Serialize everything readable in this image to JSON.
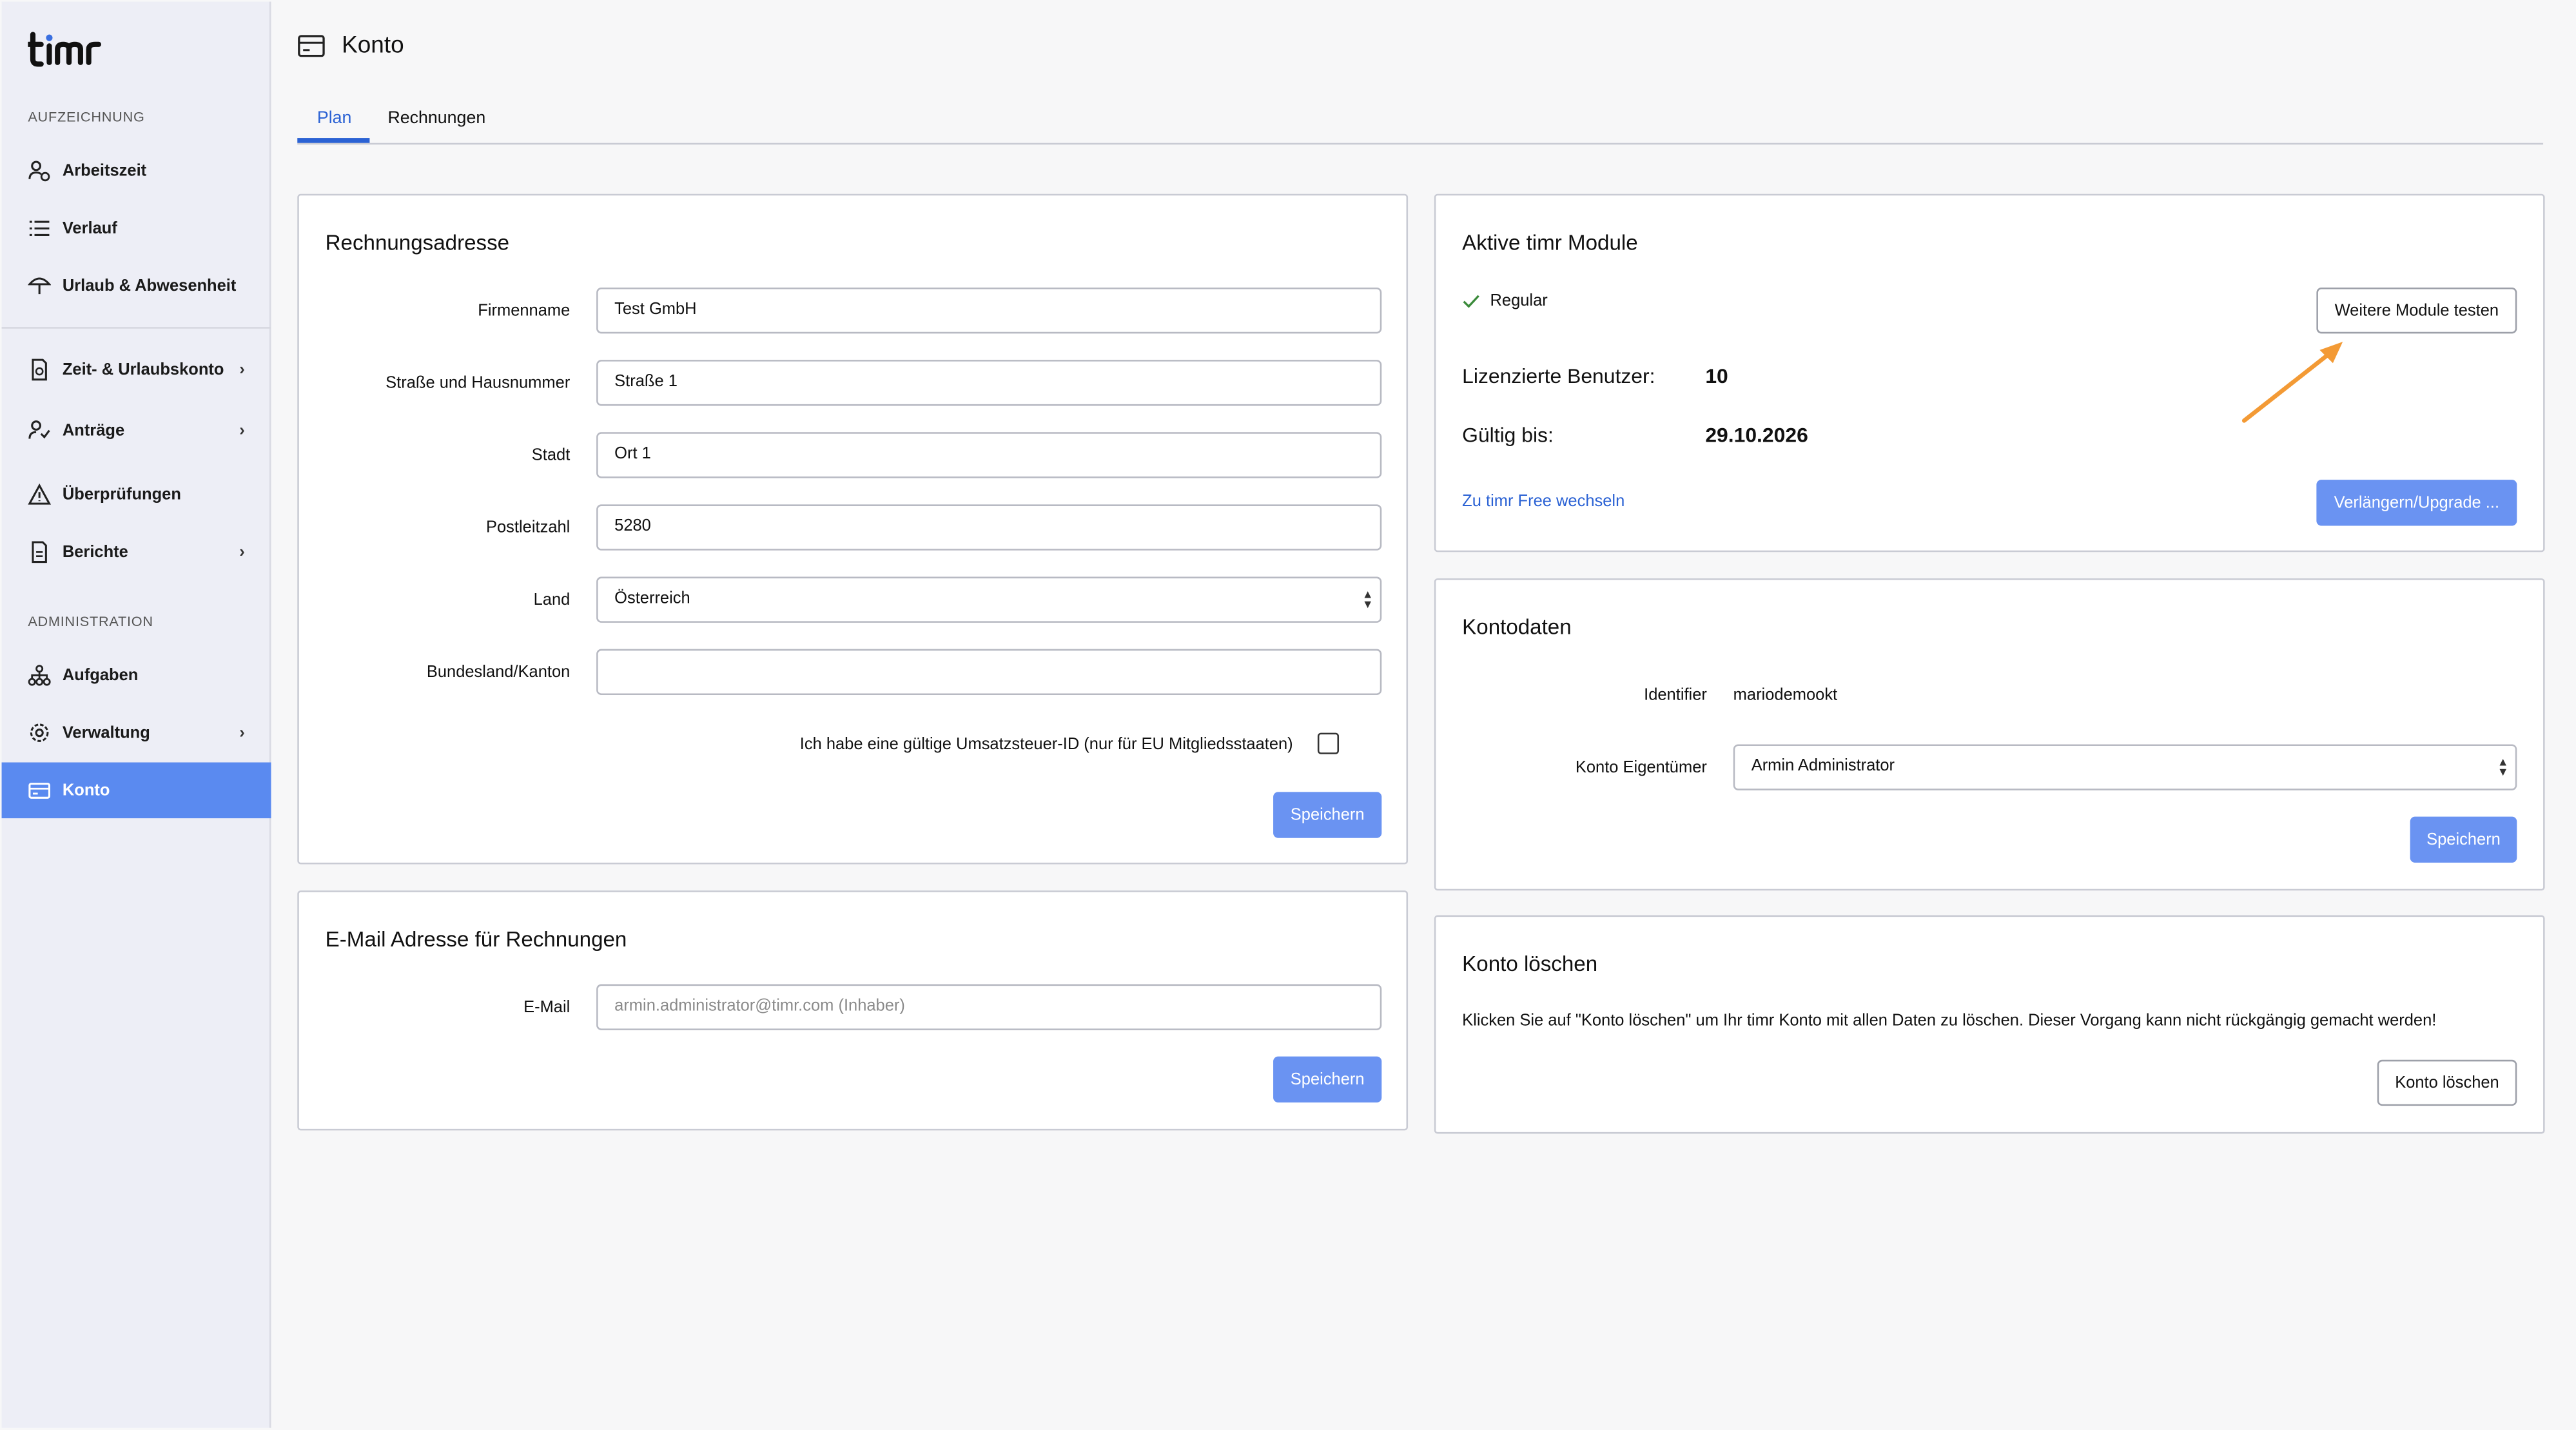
{
  "app": {
    "logo": "timr"
  },
  "sidebar": {
    "section_recording": "AUFZEICHNUNG",
    "section_admin": "ADMINISTRATION",
    "items": [
      {
        "label": "Arbeitszeit"
      },
      {
        "label": "Verlauf"
      },
      {
        "label": "Urlaub & Abwesenheit"
      },
      {
        "label": "Zeit- & Urlaubskonto"
      },
      {
        "label": "Anträge"
      },
      {
        "label": "Überprüfungen"
      },
      {
        "label": "Berichte"
      },
      {
        "label": "Aufgaben"
      },
      {
        "label": "Verwaltung"
      },
      {
        "label": "Konto"
      }
    ]
  },
  "header": {
    "title": "Konto"
  },
  "tabs": [
    {
      "label": "Plan"
    },
    {
      "label": "Rechnungen"
    }
  ],
  "billing": {
    "title": "Rechnungsadresse",
    "company_label": "Firmenname",
    "company_value": "Test GmbH",
    "street_label": "Straße und Hausnummer",
    "street_value": "Straße 1",
    "city_label": "Stadt",
    "city_value": "Ort 1",
    "zip_label": "Postleitzahl",
    "zip_value": "5280",
    "country_label": "Land",
    "country_value": "Österreich",
    "state_label": "Bundesland/Kanton",
    "state_value": "",
    "vat_label": "Ich habe eine gültige Umsatzsteuer-ID (nur für EU Mitgliedsstaaten)",
    "save_label": "Speichern"
  },
  "email": {
    "title": "E-Mail Adresse für Rechnungen",
    "email_label": "E-Mail",
    "email_placeholder": "armin.administrator@timr.com (Inhaber)",
    "save_label": "Speichern"
  },
  "modules": {
    "title": "Aktive timr Module",
    "plan": "Regular",
    "try_label": "Weitere Module testen",
    "licensed_label": "Lizenzierte Benutzer:",
    "licensed_value": "10",
    "valid_label": "Gültig bis:",
    "valid_value": "29.10.2026",
    "switch_link": "Zu timr Free wechseln",
    "upgrade_label": "Verlängern/Upgrade ..."
  },
  "account": {
    "title": "Kontodaten",
    "identifier_label": "Identifier",
    "identifier_value": "mariodemookt",
    "owner_label": "Konto Eigentümer",
    "owner_value": "Armin Administrator",
    "save_label": "Speichern"
  },
  "delete": {
    "title": "Konto löschen",
    "description": "Klicken Sie auf \"Konto löschen\" um Ihr timr Konto mit allen Daten zu löschen. Dieser Vorgang kann nicht rückgängig gemacht werden!",
    "delete_label": "Konto löschen"
  },
  "colors": {
    "accent": "#2b62d4",
    "primary_button": "#6a93f2",
    "sidebar_active": "#5a8af0",
    "annotation_arrow": "#f39a35"
  }
}
